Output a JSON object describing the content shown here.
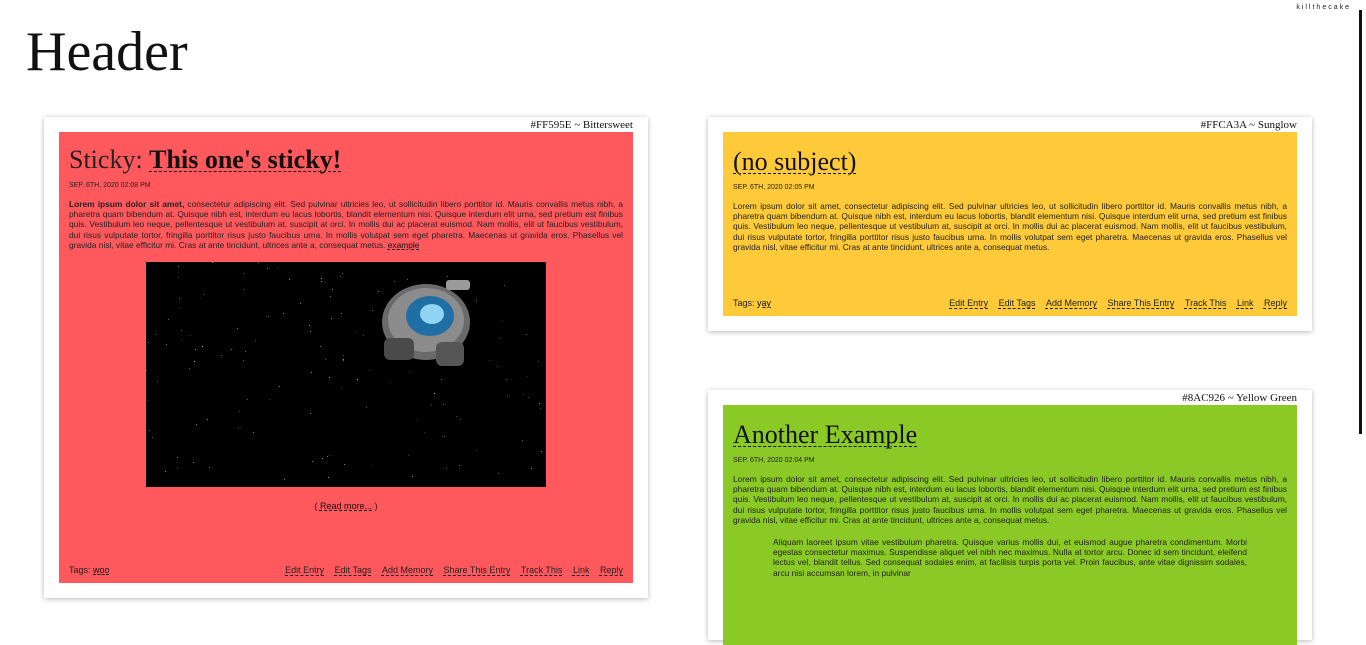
{
  "site": {
    "credit": "killthecake",
    "header": "Header"
  },
  "entries": [
    {
      "color_label": "#FF595E ~ Bittersweet",
      "bg": "#FF595E",
      "title_prefix": "Sticky: ",
      "title": "This one's sticky!",
      "date": "SEP. 6TH, 2020 02:08 PM",
      "body_bold": "Lorem ipsum dolor sit amet,",
      "body": " consectetur adipiscing elit. Sed pulvinar ultricies leo, ut sollicitudin libero porttitor id. Mauris convallis metus nibh, a pharetra quam bibendum at. Quisque nibh est, interdum eu lacus lobortis, blandit elementum nisi. Quisque interdum elit urna, sed pretium est finibus quis. Vestibulum leo neque, pellentesque ut vestibulum at, suscipit at orci. In mollis dui ac placerat euismod. Nam mollis, elit ut faucibus vestibulum, dui risus vulputate tortor, fringilla porttitor risus justo faucibus urna. In mollis volutpat sem eget pharetra. Maecenas ut gravida eros. Phasellus vel gravida nisl, vitae efficitur mi. Cras at ante tincidunt, ultrices ante a, consequat metus. ",
      "body_link": "example",
      "read_more_open": "( ",
      "read_more": "Read more...",
      "read_more_close": " )",
      "tags_label": "Tags: ",
      "tag": "woo",
      "actions": [
        "Edit Entry",
        "Edit Tags",
        "Add Memory",
        "Share This Entry",
        "Track This",
        "Link",
        "Reply"
      ]
    },
    {
      "color_label": "#FFCA3A ~ Sunglow",
      "bg": "#FFCA3A",
      "title": "(no subject)",
      "date": "SEP. 6TH, 2020 02:05 PM",
      "body": "Lorem ipsum dolor sit amet, consectetur adipiscing elit. Sed pulvinar ultricies leo, ut sollicitudin libero porttitor id. Mauris convallis metus nibh, a pharetra quam bibendum at. Quisque nibh est, interdum eu lacus lobortis, blandit elementum nisi. Quisque interdum elit urna, sed pretium est finibus quis. Vestibulum leo neque, pellentesque ut vestibulum at, suscipit at orci. In mollis dui ac placerat euismod. Nam mollis, elit ut faucibus vestibulum, dui risus vulputate tortor, fringilla porttitor risus justo faucibus urna. In mollis volutpat sem eget pharetra. Maecenas ut gravida eros. Phasellus vel gravida nisl, vitae efficitur mi. Cras at ante tincidunt, ultrices ante a, consequat metus.",
      "tags_label": "Tags: ",
      "tag": "yay",
      "actions": [
        "Edit Entry",
        "Edit Tags",
        "Add Memory",
        "Share This Entry",
        "Track This",
        "Link",
        "Reply"
      ]
    },
    {
      "color_label": "#8AC926 ~ Yellow Green",
      "bg": "#8AC926",
      "title": "Another Example",
      "date": "SEP. 6TH, 2020 02:04 PM",
      "body": "Lorem ipsum dolor sit amet, consectetur adipiscing elit. Sed pulvinar ultricies leo, ut sollicitudin libero porttitor id. Mauris convallis metus nibh, a pharetra quam bibendum at. Quisque nibh est, interdum eu lacus lobortis, blandit elementum nisi. Quisque interdum elit urna, sed pretium est finibus quis. Vestibulum leo neque, pellentesque ut vestibulum at, suscipit at orci. In mollis dui ac placerat euismod. Nam mollis, elit ut faucibus vestibulum, dui risus vulputate tortor, fringilla porttitor risus justo faucibus urna. In mollis volutpat sem eget pharetra. Maecenas ut gravida eros. Phasellus vel gravida nisl, vitae efficitur mi. Cras at ante tincidunt, ultrices ante a, consequat metus.",
      "quote": "Aliquam laoreet ipsum vitae vestibulum pharetra. Quisque varius mollis dui, et euismod augue pharetra condimentum. Morbi egestas consectetur maximus. Suspendisse aliquet vel nibh nec maximus. Nulla at tortor arcu. Donec id sem tincidunt, eleifend lectus vel, blandit tellus. Sed consequat sodales enim, at facilisis turpis porta vel. Proin faucibus, ante vitae dignissim sodales, arcu nisi accumsan lorem, in pulvinar"
    }
  ]
}
